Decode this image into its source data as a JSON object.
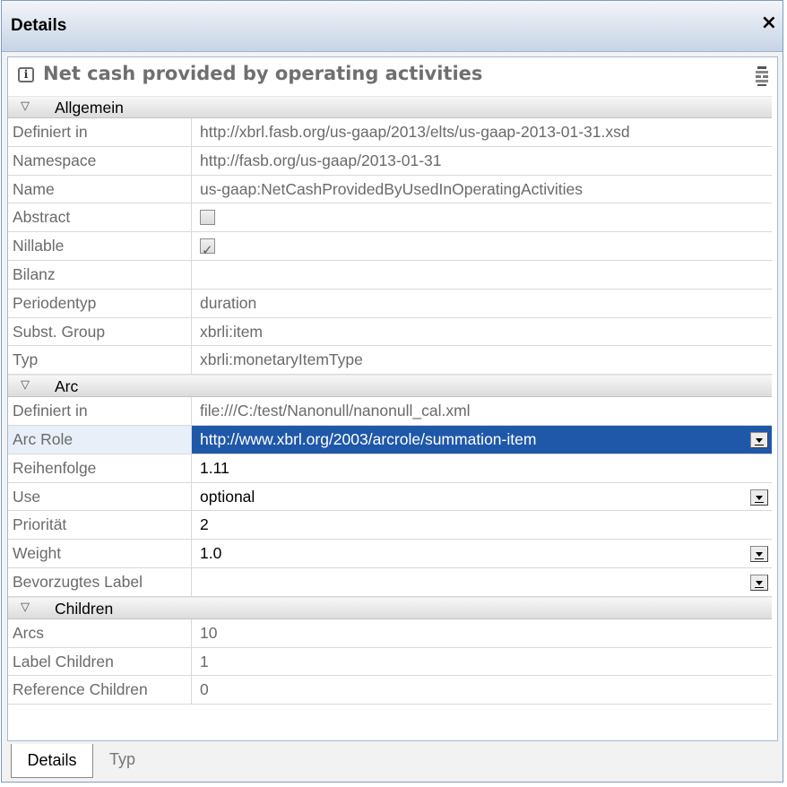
{
  "window": {
    "title": "Details",
    "close_glyph": "×"
  },
  "header": {
    "title": "Net cash provided by operating activities",
    "info_icon_glyph": "i"
  },
  "groups": {
    "allgemein": "Allgemein",
    "arc": "Arc",
    "children": "Children"
  },
  "allgemein": [
    {
      "label": "Definiert in",
      "value": "http://xbrl.fasb.org/us-gaap/2013/elts/us-gaap-2013-01-31.xsd"
    },
    {
      "label": "Namespace",
      "value": "http://fasb.org/us-gaap/2013-01-31"
    },
    {
      "label": "Name",
      "value": "us-gaap:NetCashProvidedByUsedInOperatingActivities"
    },
    {
      "label": "Abstract",
      "checked": false
    },
    {
      "label": "Nillable",
      "checked": true
    },
    {
      "label": "Bilanz",
      "value": ""
    },
    {
      "label": "Periodentyp",
      "value": "duration"
    },
    {
      "label": "Subst. Group",
      "value": "xbrli:item"
    },
    {
      "label": "Typ",
      "value": "xbrli:monetaryItemType"
    }
  ],
  "arc": [
    {
      "label": "Definiert in",
      "value": "file:///C:/test/Nanonull/nanonull_cal.xml"
    },
    {
      "label": "Arc Role",
      "value": "http://www.xbrl.org/2003/arcrole/summation-item",
      "selected": true,
      "dropdown": true
    },
    {
      "label": "Reihenfolge",
      "value": "1.11"
    },
    {
      "label": "Use",
      "value": "optional",
      "dropdown": true
    },
    {
      "label": "Priorität",
      "value": "2"
    },
    {
      "label": "Weight",
      "value": "1.0",
      "dropdown": true
    },
    {
      "label": "Bevorzugtes Label",
      "value": "",
      "dropdown": true
    }
  ],
  "children": [
    {
      "label": "Arcs",
      "value": "10"
    },
    {
      "label": "Label Children",
      "value": "1"
    },
    {
      "label": "Reference Children",
      "value": "0"
    }
  ],
  "tabs": [
    {
      "label": "Details",
      "active": true
    },
    {
      "label": "Typ",
      "active": false
    }
  ],
  "icons": {
    "info": "info-icon",
    "layout": "layout-toggle-icon",
    "collapse": "collapse-triangle-icon",
    "dropdown": "dropdown-arrow-icon",
    "close": "close-icon"
  },
  "colors": {
    "title_bar_top": "#f3f5f9",
    "title_bar_bottom": "#c7d4e6",
    "selection": "#1f58a8",
    "label_text": "#6a6a6a"
  }
}
